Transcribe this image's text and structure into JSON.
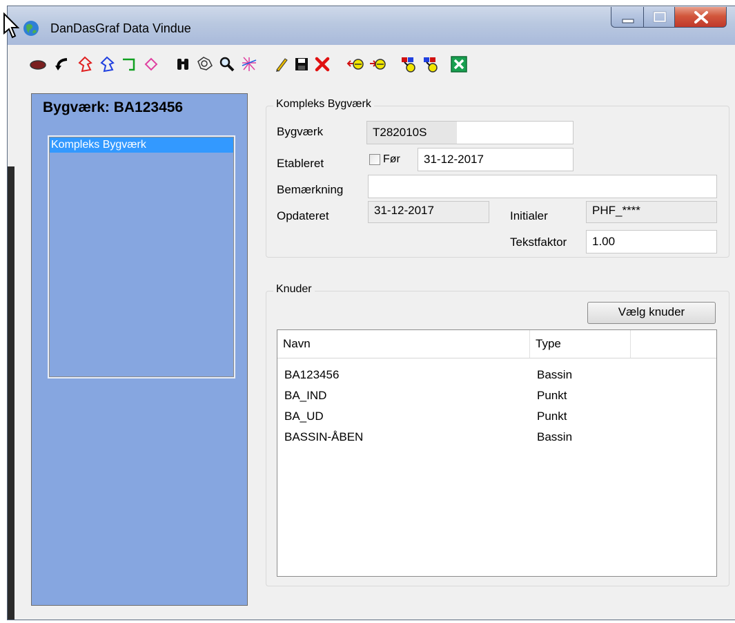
{
  "window": {
    "title": "DanDasGraf  Data Vindue"
  },
  "toolbar": {
    "tools": [
      "ellipse-icon",
      "arrow-curve-icon",
      "polygon-red-icon",
      "polygon-blue-icon",
      "polyline-green-icon",
      "polygon-pink-icon",
      "binoculars-icon",
      "zoom-pan-icon",
      "magnifier-icon",
      "network-icon",
      "pencil-icon",
      "save-icon",
      "delete-icon",
      "add-node-icon",
      "remove-node-icon",
      "node-link-icon",
      "node-unlink-icon",
      "close-window-icon"
    ]
  },
  "left_panel": {
    "title": "Bygværk: BA123456",
    "tree_items": [
      "Kompleks Bygværk"
    ]
  },
  "kompleks": {
    "group_label": "Kompleks Bygværk",
    "bygvaerk_label": "Bygværk",
    "bygvaerk_value": "T282010S",
    "etableret_label": "Etableret",
    "foer_label": "Før",
    "etableret_value": "31-12-2017",
    "bemaerkning_label": "Bemærkning",
    "bemaerkning_value": "",
    "opdateret_label": "Opdateret",
    "opdateret_value": "31-12-2017",
    "initialer_label": "Initialer",
    "initialer_value": "PHF_****",
    "tekstfaktor_label": "Tekstfaktor",
    "tekstfaktor_value": "1.00"
  },
  "knuder": {
    "group_label": "Knuder",
    "select_button": "Vælg knuder",
    "columns": [
      "Navn",
      "Type"
    ],
    "rows": [
      {
        "navn": "BA123456",
        "type": "Bassin"
      },
      {
        "navn": "BA_IND",
        "type": "Punkt"
      },
      {
        "navn": "BA_UD",
        "type": "Punkt"
      },
      {
        "navn": "BASSIN-ÅBEN",
        "type": "Bassin"
      }
    ]
  }
}
